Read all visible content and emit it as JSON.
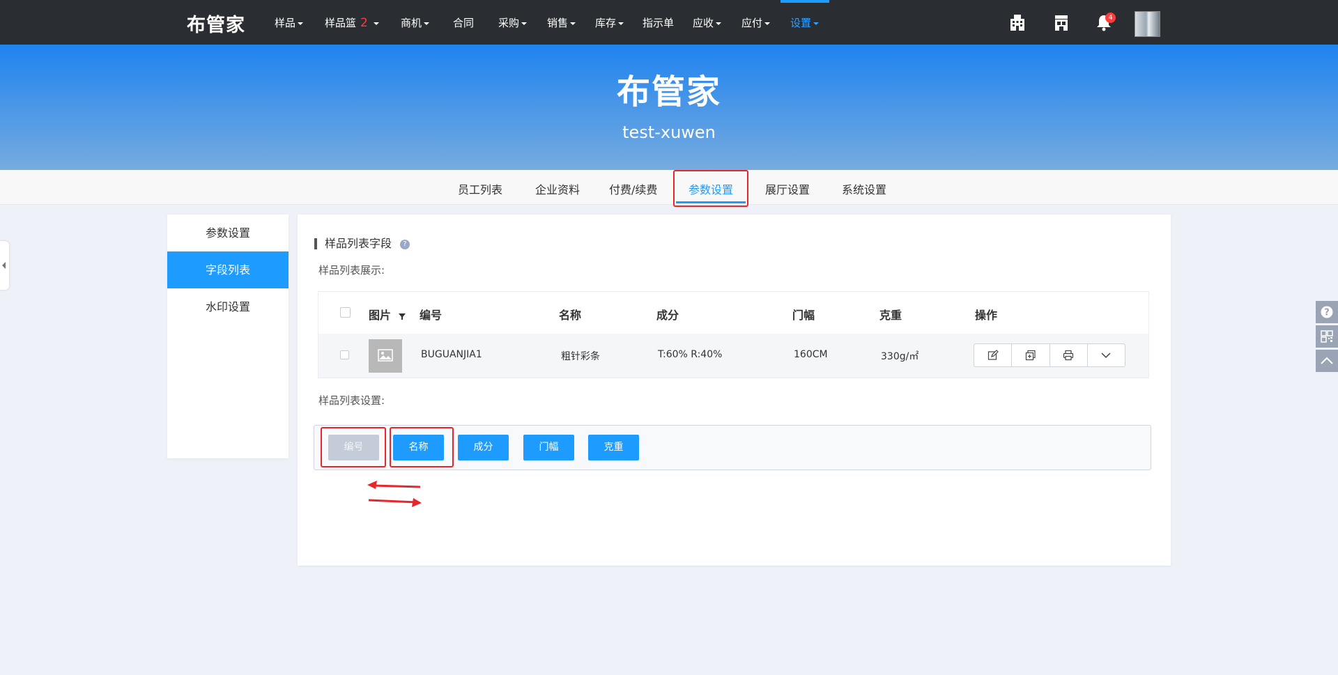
{
  "app": {
    "logo": "布管家"
  },
  "nav": {
    "items": [
      {
        "label": "样品"
      },
      {
        "label": "样品篮",
        "count": "2"
      },
      {
        "label": "商机"
      },
      {
        "label": "合同"
      },
      {
        "label": "采购"
      },
      {
        "label": "销售"
      },
      {
        "label": "库存"
      },
      {
        "label": "指示单"
      },
      {
        "label": "应收"
      },
      {
        "label": "应付"
      },
      {
        "label": "设置"
      }
    ],
    "notification_count": "4"
  },
  "banner": {
    "title": "布管家",
    "subtitle": "test-xuwen"
  },
  "tabs": [
    {
      "label": "员工列表"
    },
    {
      "label": "企业资料"
    },
    {
      "label": "付费/续费"
    },
    {
      "label": "参数设置"
    },
    {
      "label": "展厅设置"
    },
    {
      "label": "系统设置"
    }
  ],
  "sidemenu": [
    {
      "label": "参数设置"
    },
    {
      "label": "字段列表"
    },
    {
      "label": "水印设置"
    }
  ],
  "main": {
    "section_title": "样品列表字段",
    "display_label": "样品列表展示:",
    "settings_label": "样品列表设置:",
    "table": {
      "headers": [
        "图片",
        "编号",
        "名称",
        "成分",
        "门幅",
        "克重",
        "操作"
      ],
      "row": {
        "code": "BUGUANJIA1",
        "name": "粗针彩条",
        "composition": "T:60% R:40%",
        "width": "160CM",
        "weight": "330g/㎡"
      }
    },
    "fields": [
      {
        "label": "编号",
        "state": "disabled"
      },
      {
        "label": "名称",
        "state": "enabled"
      },
      {
        "label": "成分",
        "state": "enabled"
      },
      {
        "label": "门幅",
        "state": "enabled"
      },
      {
        "label": "克重",
        "state": "enabled"
      }
    ]
  },
  "colors": {
    "accent": "#1e9bff",
    "nav_bg": "#2a2d31",
    "highlight": "#e8262b"
  }
}
